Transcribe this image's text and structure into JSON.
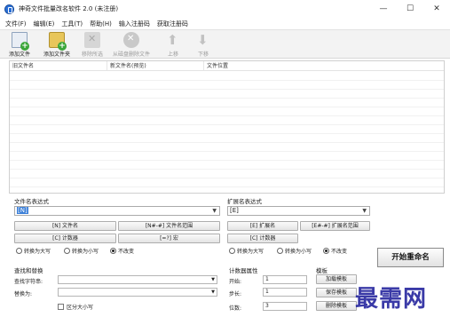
{
  "window": {
    "title": "神奇文件批量改名软件 2.0 (未注册)",
    "minimize": "—",
    "maximize": "☐",
    "close": "✕"
  },
  "menu": [
    "文件(F)",
    "编辑(E)",
    "工具(T)",
    "帮助(H)",
    "输入注册码",
    "获取注册码"
  ],
  "toolbar": {
    "add_file": "添加文件",
    "add_folder": "添加文件夹",
    "remove_selected": "移除所选",
    "delete_from_disk": "从磁盘删除文件",
    "move_up": "上移",
    "move_down": "下移"
  },
  "list": {
    "columns": [
      "旧文件名",
      "新文件名(预览)",
      "文件位置"
    ]
  },
  "filename_expr": {
    "label": "文件名表达式",
    "value": "[N]",
    "btn_name": "[N] 文件名",
    "btn_range": "[N#-#] 文件名范围",
    "btn_counter": "[C] 计数器",
    "btn_macro": "[=?] 宏",
    "radio_upper": "转换为大写",
    "radio_lower": "转换为小写",
    "radio_none": "不改变"
  },
  "ext_expr": {
    "label": "扩展名表达式",
    "value": "[E]",
    "btn_ext": "[E] 扩展名",
    "btn_range": "[E#-#] 扩展名范围",
    "btn_counter": "[C] 计数器",
    "radio_upper": "转换为大写",
    "radio_lower": "转换为小写",
    "radio_none": "不改变"
  },
  "find_replace": {
    "label": "查找和替换",
    "find_label": "查找字符串:",
    "find_value": "",
    "replace_label": "替换为:",
    "replace_value": "",
    "case_label": "区分大小写"
  },
  "counter": {
    "label": "计数器属性",
    "start_label": "开始:",
    "start_value": "1",
    "step_label": "步长:",
    "step_value": "1",
    "digits_label": "位数:",
    "digits_value": "3"
  },
  "template": {
    "label": "模板",
    "load": "加载模板",
    "save": "保存模板",
    "delete": "删除模板"
  },
  "start_button": "开始重命名",
  "watermark": "最需网"
}
